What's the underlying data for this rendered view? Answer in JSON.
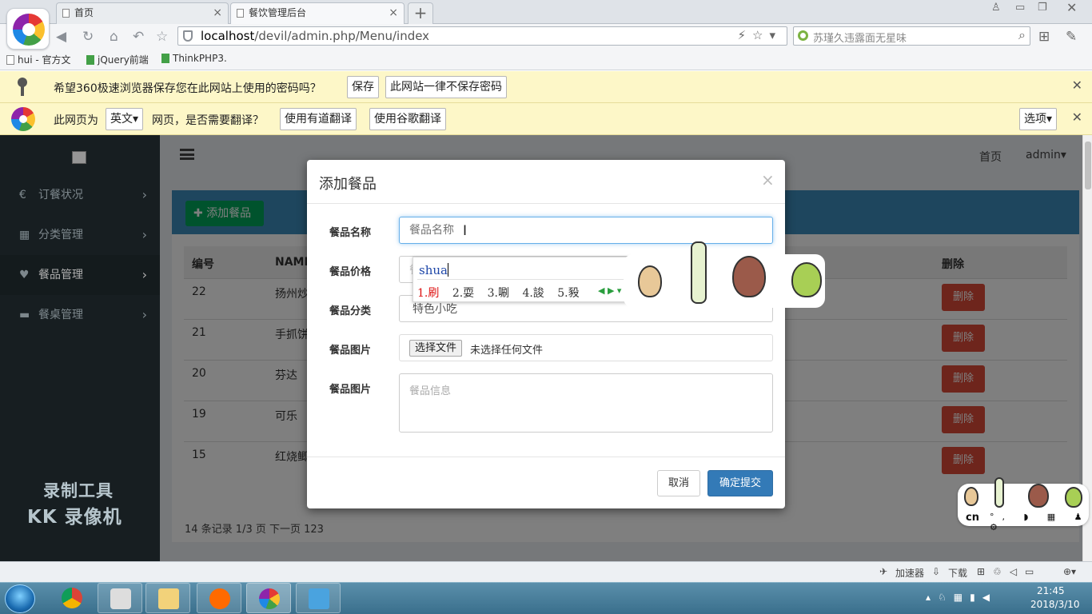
{
  "browser": {
    "tabs": [
      {
        "label": "首页",
        "active": false
      },
      {
        "label": "餐饮管理后台",
        "active": true
      }
    ],
    "new_tab": "+",
    "url_host": "localhost",
    "url_path": "/devil/admin.php/Menu/index",
    "search_text": "苏瑾久违露面无星味",
    "bookmarks": [
      "hui - 官方文",
      "jQuery前端",
      "ThinkPHP3."
    ]
  },
  "password_bar": {
    "message": "希望360极速浏览器保存您在此网站上使用的密码吗？",
    "save": "保存",
    "never": "此网站一律不保存密码",
    "close": "✕"
  },
  "translate_bar": {
    "prefix": "此网页为",
    "lang": "英文",
    "suffix": "网页，是否需要翻译？",
    "youdao": "使用有道翻译",
    "google": "使用谷歌翻译",
    "options": "选项",
    "close": "✕"
  },
  "sidebar": {
    "items": [
      {
        "icon": "€",
        "label": "订餐状况"
      },
      {
        "icon": "▦",
        "label": "分类管理"
      },
      {
        "icon": "♥",
        "label": "餐品管理"
      },
      {
        "icon": "▬",
        "label": "餐桌管理"
      }
    ],
    "watermark_line1": "录制工具",
    "watermark_line2": "KK 录像机"
  },
  "topnav": {
    "home": "首页",
    "user": "admin▾"
  },
  "content": {
    "add_button": "添加餐品",
    "columns": {
      "id": "编号",
      "name": "NAME",
      "delete": "删除"
    },
    "rows": [
      {
        "id": "22",
        "name": "扬州炒"
      },
      {
        "id": "21",
        "name": "手抓饼"
      },
      {
        "id": "20",
        "name": "芬达"
      },
      {
        "id": "19",
        "name": "可乐"
      },
      {
        "id": "15",
        "name": "红烧鲫"
      }
    ],
    "delete_label": "删除",
    "pager": "14 条记录 1/3 页 下一页 123"
  },
  "modal": {
    "title": "添加餐品",
    "close": "×",
    "fields": {
      "name_label": "餐品名称",
      "name_placeholder": "餐品名称",
      "price_label": "餐品价格",
      "price_value": "餐",
      "category_label": "餐品分类",
      "category_value": "特色小吃",
      "image_label": "餐品图片",
      "file_button": "选择文件",
      "file_status": "未选择任何文件",
      "info_label": "餐品图片",
      "info_placeholder": "餐品信息"
    },
    "cancel": "取消",
    "submit": "确定提交"
  },
  "ime": {
    "composition": "shua",
    "candidates": [
      "1.刷",
      "2.耍",
      "3.唰",
      "4.誜",
      "5.豛"
    ],
    "toolbar_lang": "cn",
    "toolbar_icons": "°, ◗ ▦ ♟ ⚙"
  },
  "statusbar": {
    "accelerator": "加速器",
    "download": "下载"
  },
  "clock": {
    "time": "21:45",
    "date": "2018/3/10"
  }
}
